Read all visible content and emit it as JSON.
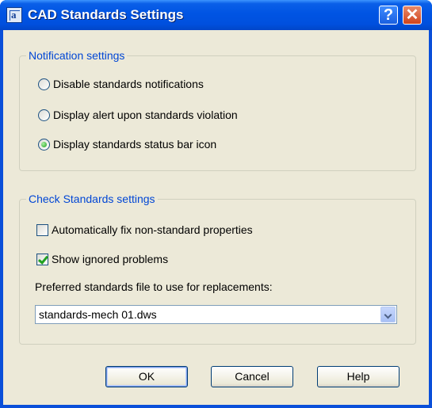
{
  "window": {
    "title": "CAD Standards Settings",
    "icon": "cad-app-icon"
  },
  "titlebar": {
    "help_label": "?",
    "close_label": "✕"
  },
  "notification": {
    "group_label": "Notification settings",
    "options": [
      {
        "label": "Disable standards notifications",
        "selected": false
      },
      {
        "label": "Display alert upon standards violation",
        "selected": false
      },
      {
        "label": "Display standards status bar icon",
        "selected": true
      }
    ]
  },
  "check": {
    "group_label": "Check Standards settings",
    "auto_fix": {
      "label": "Automatically fix non-standard properties",
      "checked": false
    },
    "show_ignored": {
      "label": "Show ignored problems",
      "checked": true
    },
    "preferred_label": "Preferred standards file to use for replacements:",
    "preferred_value": "standards-mech 01.dws"
  },
  "buttons": {
    "ok": "OK",
    "cancel": "Cancel",
    "help": "Help"
  },
  "colors": {
    "title_bar": "#0054e3",
    "group_label": "#0046d5",
    "dialog_bg": "#ece9d8"
  }
}
